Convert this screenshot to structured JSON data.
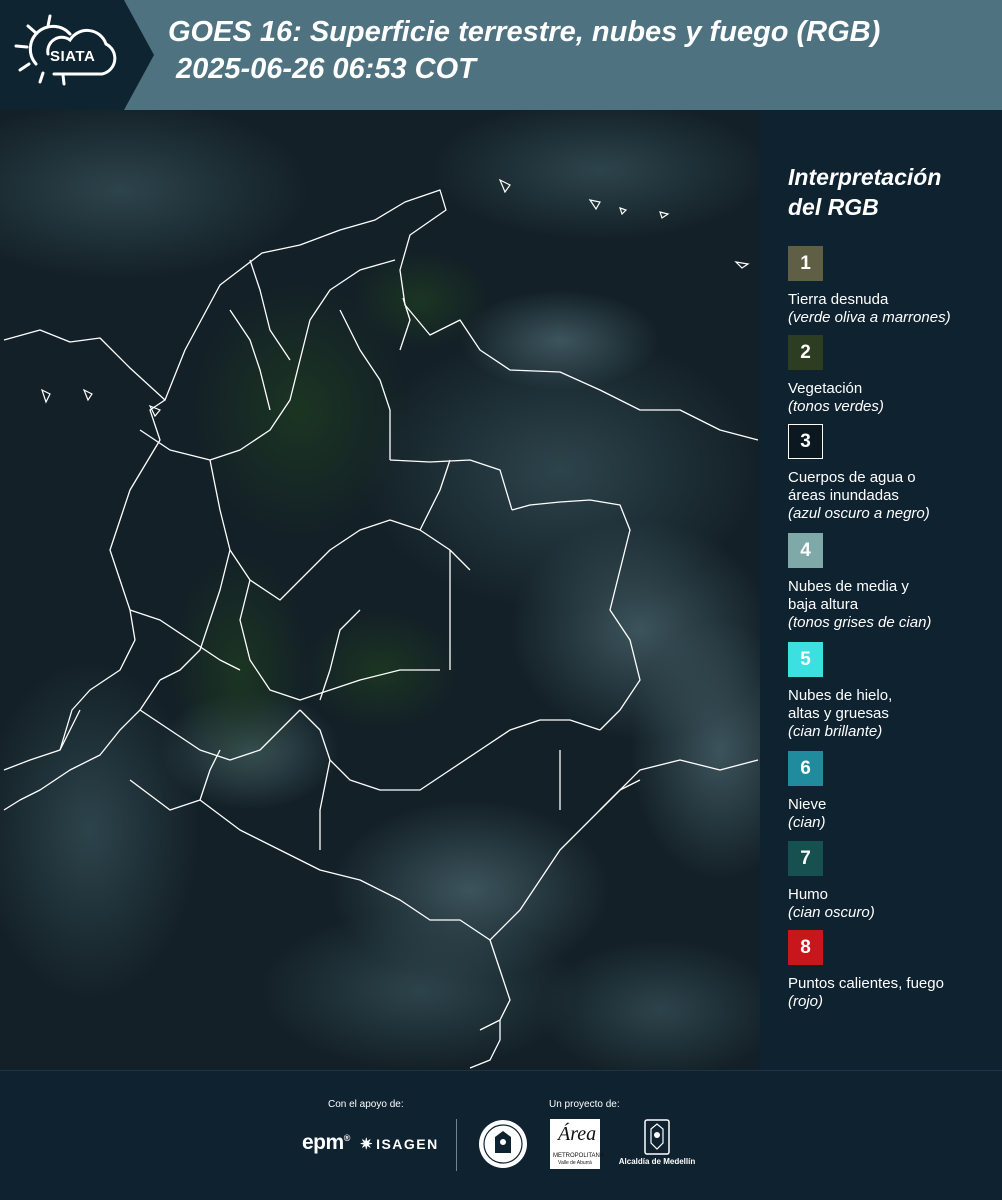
{
  "header": {
    "logo_text": "SIATA",
    "title_line1": "GOES 16: Superficie terrestre, nubes y fuego (RGB)",
    "title_line2": "2025-06-26 06:53 COT"
  },
  "legend": {
    "title_line1": "Interpretación",
    "title_line2": "del RGB",
    "items": [
      {
        "number": "1",
        "color": "#5e5f45",
        "lines": [
          "Tierra desnuda"
        ],
        "note": "(verde oliva a marrones)"
      },
      {
        "number": "2",
        "color": "#2c3d22",
        "lines": [
          "Vegetación"
        ],
        "note": "(tonos verdes)"
      },
      {
        "number": "3",
        "color": "#0c1820",
        "lines": [
          "Cuerpos de agua o",
          "áreas inundadas"
        ],
        "note": "(azul oscuro a negro)"
      },
      {
        "number": "4",
        "color": "#7fa9a8",
        "lines": [
          "Nubes de media y",
          "baja altura"
        ],
        "note": "(tonos grises de cian)"
      },
      {
        "number": "5",
        "color": "#3ce0e0",
        "lines": [
          "Nubes de hielo,",
          "altas y gruesas"
        ],
        "note": "(cian brillante)"
      },
      {
        "number": "6",
        "color": "#1f8b9c",
        "lines": [
          "Nieve"
        ],
        "note": "(cian)"
      },
      {
        "number": "7",
        "color": "#17514f",
        "lines": [
          "Humo"
        ],
        "note": "(cian oscuro)"
      },
      {
        "number": "8",
        "color": "#c8171c",
        "lines": [
          "Puntos calientes, fuego"
        ],
        "note": "(rojo)"
      }
    ]
  },
  "footer": {
    "support_label": "Con el apoyo de:",
    "project_label": "Un proyecto de:",
    "epm": "epm",
    "epm_mark": "®",
    "isagen": "ISAGEN",
    "amva_line1": "Área",
    "amva_line2": "METROPOLITANA",
    "amva_line3": "Valle de Aburrá",
    "alcaldia": "Alcaldía de Medellín"
  },
  "colors": {
    "header_dark": "#0e2431",
    "header_band": "#4f7281",
    "background": "#0f2230",
    "map_background": "#101f27"
  }
}
